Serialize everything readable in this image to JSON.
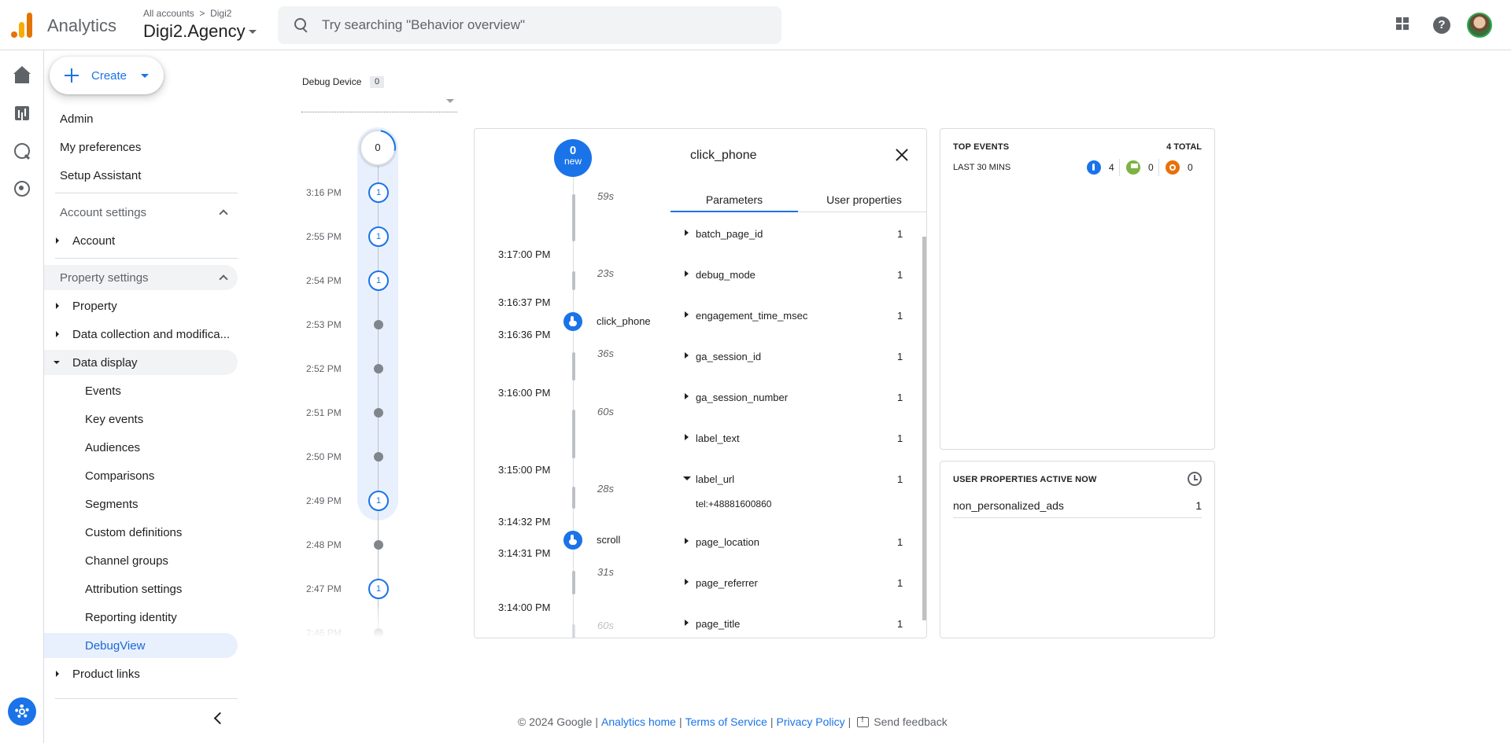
{
  "header": {
    "app_name": "Analytics",
    "breadcrumb_root": "All accounts",
    "breadcrumb_account": "Digi2",
    "account_name": "Digi2.Agency",
    "search_placeholder": "Try searching \"Behavior overview\""
  },
  "rail": {
    "icons": [
      "home-icon",
      "reports-icon",
      "explore-icon",
      "advertising-icon",
      "settings-icon"
    ]
  },
  "nav": {
    "create_label": "Create",
    "admin": "Admin",
    "my_preferences": "My preferences",
    "setup_assistant": "Setup Assistant",
    "account_settings": "Account settings",
    "account": "Account",
    "property_settings": "Property settings",
    "property": "Property",
    "data_collection": "Data collection and modifica...",
    "data_display": "Data display",
    "events": "Events",
    "key_events": "Key events",
    "audiences": "Audiences",
    "comparisons": "Comparisons",
    "segments": "Segments",
    "custom_definitions": "Custom definitions",
    "channel_groups": "Channel groups",
    "attribution_settings": "Attribution settings",
    "reporting_identity": "Reporting identity",
    "debugview": "DebugView",
    "product_links": "Product links"
  },
  "debug_device": {
    "label": "Debug Device",
    "count": "0"
  },
  "minutes": {
    "top_count": "0",
    "rows": [
      {
        "time": "3:16 PM",
        "count": "1"
      },
      {
        "time": "2:55 PM",
        "count": "1"
      },
      {
        "time": "2:54 PM",
        "count": "1"
      },
      {
        "time": "2:53 PM",
        "count": ""
      },
      {
        "time": "2:52 PM",
        "count": ""
      },
      {
        "time": "2:51 PM",
        "count": ""
      },
      {
        "time": "2:50 PM",
        "count": ""
      },
      {
        "time": "2:49 PM",
        "count": "1"
      },
      {
        "time": "2:48 PM",
        "count": ""
      },
      {
        "time": "2:47 PM",
        "count": "1"
      },
      {
        "time": "2:46 PM",
        "count": ""
      }
    ]
  },
  "seconds": {
    "new_count": "0",
    "new_label": "new",
    "gaps": [
      "59s",
      "23s",
      "36s",
      "60s",
      "28s",
      "31s",
      "60s"
    ],
    "times": [
      "3:17:00 PM",
      "3:16:37 PM",
      "3:16:36 PM",
      "3:16:00 PM",
      "3:15:00 PM",
      "3:14:32 PM",
      "3:14:31 PM",
      "3:14:00 PM"
    ],
    "events": [
      "click_phone",
      "scroll"
    ]
  },
  "detail": {
    "title": "click_phone",
    "tab_parameters": "Parameters",
    "tab_user_properties": "User properties",
    "params": [
      {
        "key": "batch_page_id",
        "value": "1"
      },
      {
        "key": "debug_mode",
        "value": "1"
      },
      {
        "key": "engagement_time_msec",
        "value": "1"
      },
      {
        "key": "ga_session_id",
        "value": "1"
      },
      {
        "key": "ga_session_number",
        "value": "1"
      },
      {
        "key": "label_text",
        "value": "1"
      },
      {
        "key": "label_url",
        "value": "1"
      },
      {
        "key": "page_location",
        "value": "1"
      },
      {
        "key": "page_referrer",
        "value": "1"
      },
      {
        "key": "page_title",
        "value": "1"
      }
    ],
    "label_url_value": "tel:+48881600860"
  },
  "top_events": {
    "title": "TOP EVENTS",
    "total": "4 TOTAL",
    "period": "LAST 30 MINS",
    "counts": [
      {
        "icon": "event-icon",
        "value": "4",
        "color": "#1a73e8"
      },
      {
        "icon": "key-event-icon",
        "value": "0",
        "color": "#7cb342"
      },
      {
        "icon": "error-icon",
        "value": "0",
        "color": "#e8710a"
      }
    ]
  },
  "user_props": {
    "title": "USER PROPERTIES ACTIVE NOW",
    "rows": [
      {
        "key": "non_personalized_ads",
        "value": "1"
      }
    ]
  },
  "footer": {
    "copyright": "© 2024 Google",
    "analytics_home": "Analytics home",
    "terms": "Terms of Service",
    "privacy": "Privacy Policy",
    "feedback": "Send feedback"
  },
  "colors": {
    "accent": "#1a73e8",
    "active_bg": "#e8f0fe"
  }
}
